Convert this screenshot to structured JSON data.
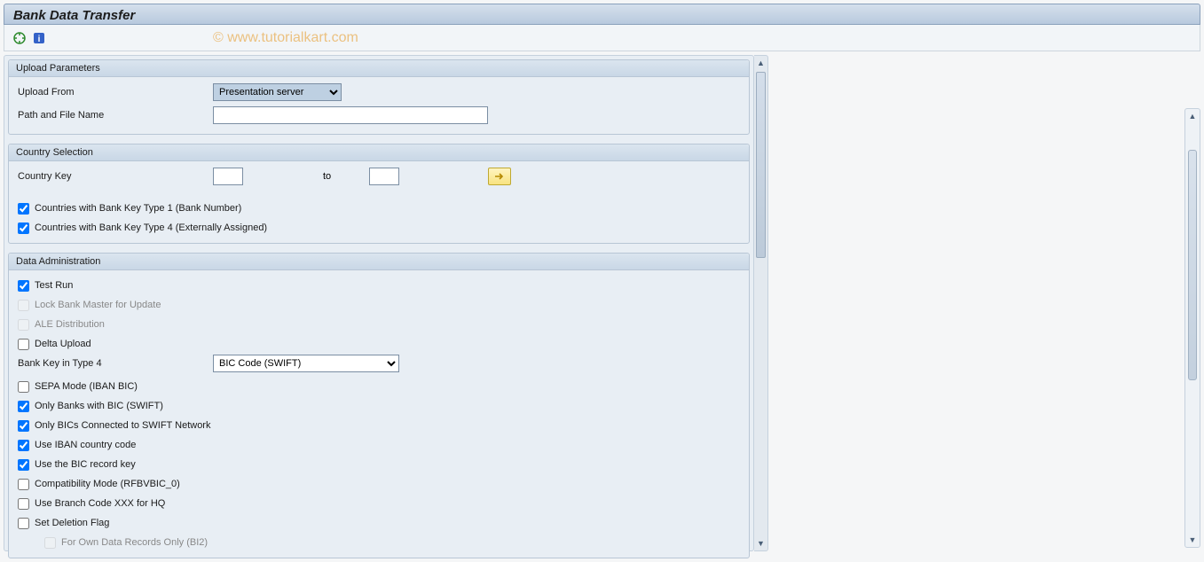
{
  "header": {
    "title": "Bank Data Transfer"
  },
  "watermark": "© www.tutorialkart.com",
  "groups": {
    "upload": {
      "title": "Upload Parameters",
      "upload_from_label": "Upload From",
      "upload_from_value": "Presentation server",
      "path_label": "Path and File Name",
      "path_value": ""
    },
    "country": {
      "title": "Country Selection",
      "key_label": "Country Key",
      "key_from": "",
      "to_label": "to",
      "key_to": "",
      "cb_type1": "Countries with Bank Key Type 1 (Bank Number)",
      "cb_type4": "Countries with Bank Key Type 4 (Externally Assigned)"
    },
    "admin": {
      "title": "Data Administration",
      "test_run": "Test Run",
      "lock_bank": "Lock Bank Master for Update",
      "ale": "ALE Distribution",
      "delta": "Delta Upload",
      "bank_key_type4_label": "Bank Key in Type 4",
      "bank_key_type4_value": "BIC Code (SWIFT)",
      "sepa": "SEPA Mode (IBAN BIC)",
      "only_bic": "Only Banks with BIC (SWIFT)",
      "only_bics_conn": "Only BICs Connected to SWIFT Network",
      "use_iban": "Use IBAN country code",
      "use_bic_record": "Use the BIC record key",
      "compat": "Compatibility Mode (RFBVBIC_0)",
      "branch_hq": "Use Branch Code XXX for HQ",
      "set_del": "Set Deletion Flag",
      "own_data": "For Own Data Records Only (BI2)"
    }
  }
}
